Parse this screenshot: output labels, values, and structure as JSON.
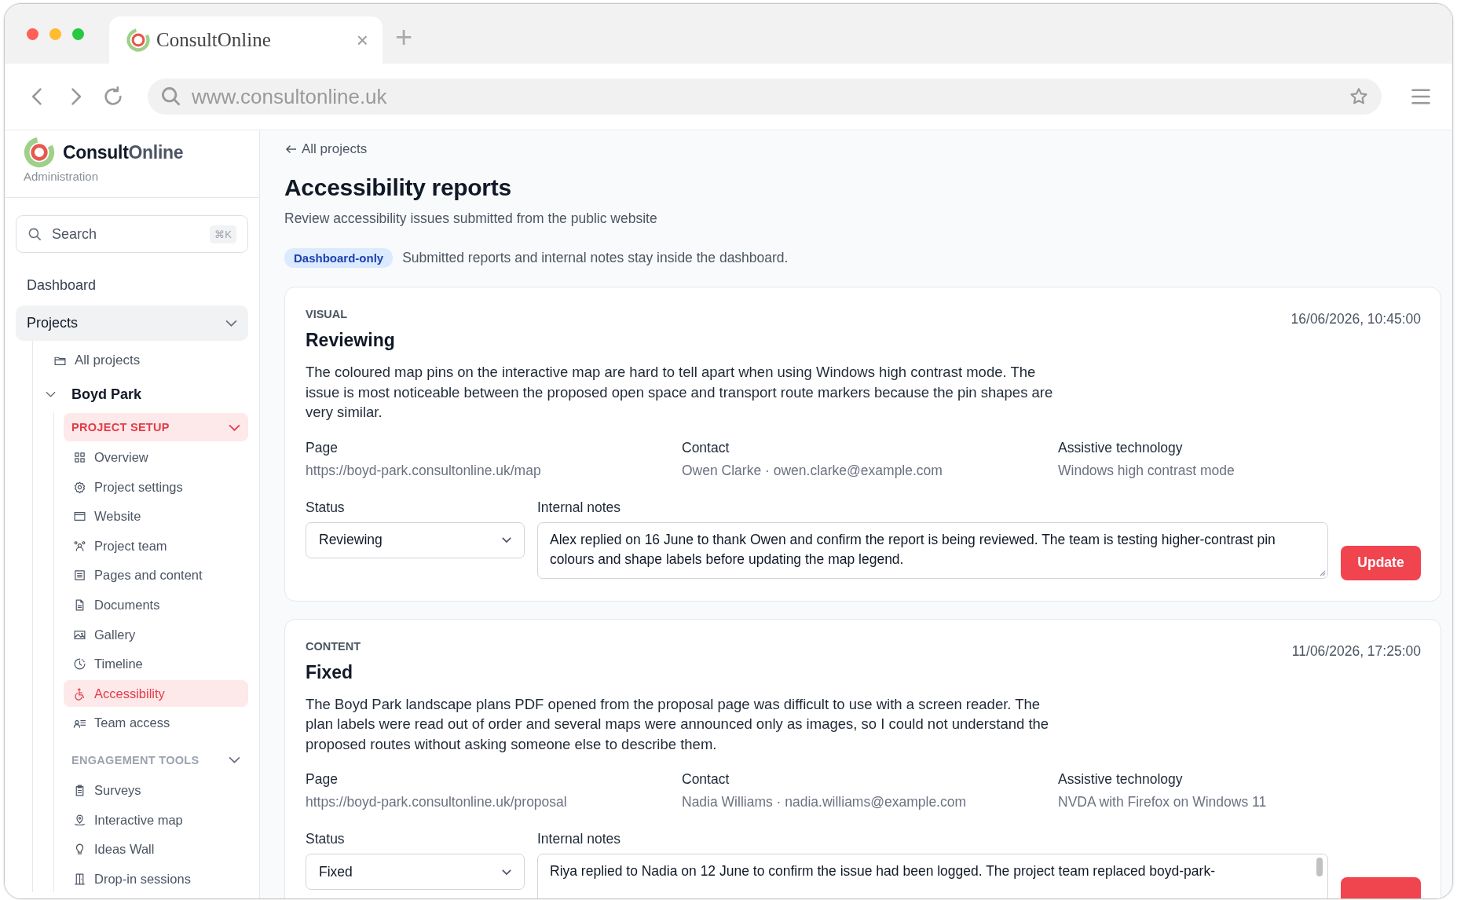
{
  "browser": {
    "tab_title": "ConsultOnline",
    "tab_close": "×",
    "new_tab": "+",
    "url": "www.consultonline.uk"
  },
  "sidebar": {
    "brand": {
      "name_dark": "Consult",
      "name_light": "Online",
      "subtitle": "Administration"
    },
    "search": {
      "placeholder": "Search",
      "shortcut": "⌘K"
    },
    "dashboard": {
      "label": "Dashboard",
      "selected": false
    },
    "projects": {
      "label": "Projects",
      "expanded": true,
      "all_projects": {
        "label": "All projects",
        "selected": false
      },
      "project": {
        "label": "Boyd Park",
        "expanded": true,
        "sections": [
          {
            "label": "PROJECT SETUP",
            "expanded": true,
            "selected": true,
            "items": [
              {
                "label": "Overview",
                "selected": false
              },
              {
                "label": "Project settings",
                "selected": false
              },
              {
                "label": "Website",
                "selected": false
              },
              {
                "label": "Project team",
                "selected": false
              },
              {
                "label": "Pages and content",
                "selected": false
              },
              {
                "label": "Documents",
                "selected": false
              },
              {
                "label": "Gallery",
                "selected": false
              },
              {
                "label": "Timeline",
                "selected": false
              },
              {
                "label": "Accessibility",
                "selected": true
              },
              {
                "label": "Team access",
                "selected": false
              }
            ]
          },
          {
            "label": "ENGAGEMENT TOOLS",
            "expanded": true,
            "selected": false,
            "items": [
              {
                "label": "Surveys",
                "selected": false
              },
              {
                "label": "Interactive map",
                "selected": false
              },
              {
                "label": "Ideas Wall",
                "selected": false
              },
              {
                "label": "Drop-in sessions",
                "selected": false
              }
            ]
          }
        ]
      }
    }
  },
  "main": {
    "back_link": "All projects",
    "title": "Accessibility reports",
    "subtitle": "Review accessibility issues submitted from the public website",
    "notice": {
      "badge": "Dashboard-only",
      "text": "Submitted reports and internal notes stay inside the dashboard."
    },
    "reports": [
      {
        "category": "VISUAL",
        "status_title": "Reviewing",
        "timestamp": "16/06/2026, 10:45:00",
        "description": "The coloured map pins on the interactive map are hard to tell apart when using Windows high contrast mode. The issue is most noticeable between the proposed open space and transport route markers because the pin shapes are very similar.",
        "fields": [
          {
            "label": "Page",
            "value": "https://boyd-park.consultonline.uk/map"
          },
          {
            "label": "Contact",
            "value": "Owen Clarke · owen.clarke@example.com"
          },
          {
            "label": "Assistive technology",
            "value": "Windows high contrast mode"
          }
        ],
        "status_label": "Status",
        "status_value": "Reviewing",
        "notes_label": "Internal notes",
        "notes": "Alex replied on 16 June to thank Owen and confirm the report is being reviewed. The team is testing higher-contrast pin colours and shape labels before updating the map legend.",
        "scrollbar": false,
        "button": "Update"
      },
      {
        "category": "CONTENT",
        "status_title": "Fixed",
        "timestamp": "11/06/2026, 17:25:00",
        "description": "The Boyd Park landscape plans PDF opened from the proposal page was difficult to use with a screen reader. The plan labels were read out of order and several maps were announced only as images, so I could not understand the proposed routes without asking someone else to describe them.",
        "fields": [
          {
            "label": "Page",
            "value": "https://boyd-park.consultonline.uk/proposal"
          },
          {
            "label": "Contact",
            "value": "Nadia Williams · nadia.williams@example.com"
          },
          {
            "label": "Assistive technology",
            "value": "NVDA with Firefox on Windows 11"
          }
        ],
        "status_label": "Status",
        "status_value": "Fixed",
        "notes_label": "Internal notes",
        "notes": "Riya replied to Nadia on 12 June to confirm the issue had been logged. The project team replaced boyd-park-",
        "scrollbar": true
      }
    ]
  }
}
